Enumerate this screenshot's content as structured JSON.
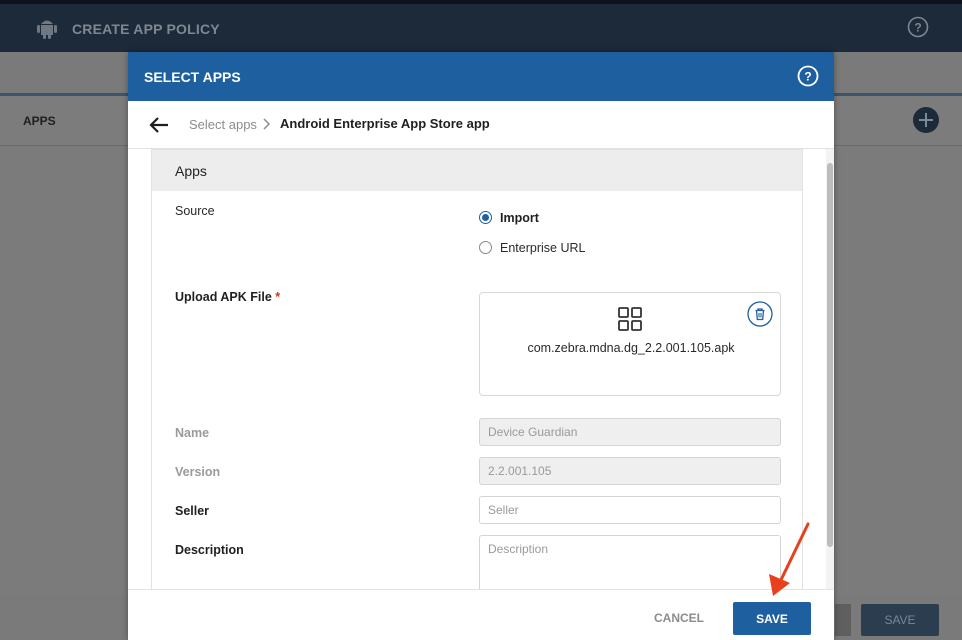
{
  "background": {
    "header_title": "CREATE APP POLICY",
    "section_label": "APPS",
    "save_label": "SAVE"
  },
  "modal": {
    "title": "SELECT APPS",
    "breadcrumb": {
      "parent": "Select apps",
      "current": "Android Enterprise App Store app"
    },
    "panel_title": "Apps",
    "source": {
      "label": "Source",
      "options": [
        "Import",
        "Enterprise URL"
      ],
      "selected": "Import"
    },
    "upload": {
      "label": "Upload APK File",
      "required_mark": "*",
      "file_name": "com.zebra.mdna.dg_2.2.001.105.apk"
    },
    "fields": {
      "name_label": "Name",
      "name_value": "Device Guardian",
      "version_label": "Version",
      "version_value": "2.2.001.105",
      "seller_label": "Seller",
      "seller_placeholder": "Seller",
      "description_label": "Description",
      "description_placeholder": "Description"
    },
    "footer": {
      "cancel_label": "CANCEL",
      "save_label": "SAVE"
    }
  },
  "colors": {
    "accent": "#1e5fa0",
    "header_dark": "#1c2a39",
    "annotation_arrow": "#e8401c"
  },
  "icons": [
    "android-icon",
    "help-icon",
    "add-icon",
    "back-arrow-icon",
    "chevron-right-icon",
    "app-grid-icon",
    "trash-icon",
    "annotation-arrow"
  ]
}
